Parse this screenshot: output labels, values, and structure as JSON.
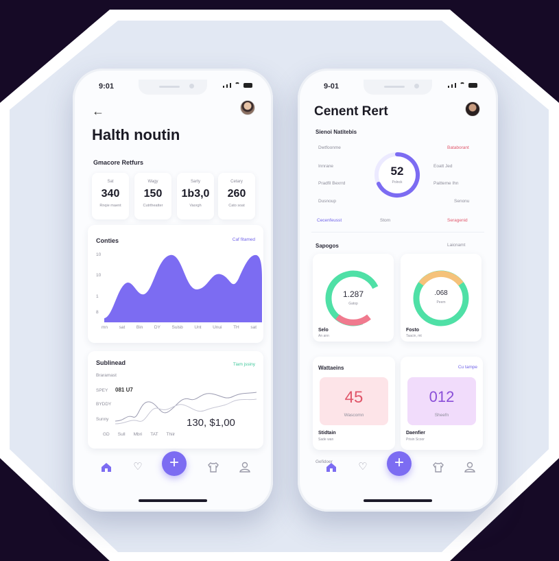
{
  "left": {
    "status_time": "9:01",
    "title": "Halth noutin",
    "stats_label": "Gmacore Retfurs",
    "stats": [
      {
        "label": "Sat",
        "value": "340",
        "sub": "Rnqie maent"
      },
      {
        "label": "Wagy",
        "value": "150",
        "sub": "Cutrtheatter"
      },
      {
        "label": "Sarty",
        "value": "1b3,0",
        "sub": "Vaorgh"
      },
      {
        "label": "Cetary",
        "value": "260",
        "sub": "Cato soat"
      }
    ],
    "calories": {
      "title": "Conties",
      "link": "Caf fitamed",
      "y_ticks": [
        "10",
        "10",
        "1",
        "8"
      ],
      "x_ticks": [
        "mn",
        "sat",
        "Bin",
        "DY",
        "Sulsb",
        "Unt",
        "Unui",
        "TH",
        "sat"
      ]
    },
    "sublined": {
      "title": "Sublinead",
      "link": "Tiam jssiny",
      "caption": "Braramast",
      "y_ticks": [
        "SPEY",
        "BYDDY",
        "Sunny"
      ],
      "reading": "081 U7",
      "big_value": "130, $1,00",
      "x_ticks": [
        "GD",
        "Sull",
        "Mbri",
        "TAT",
        "Thiir"
      ]
    }
  },
  "right": {
    "status_time": "9-01",
    "title": "Cenent Rert",
    "section1_label": "Sienoi Natitebis",
    "ring_value": "52",
    "ring_sub": "Polnck",
    "rows_left": [
      "Dwtfoonme",
      "Innrane",
      "Pradfil Bexrrd",
      "Dusnoup"
    ],
    "rows_right": [
      "Bataborant",
      "Eoatt   Jed",
      "Paitteme  Ihn",
      "Senonu"
    ],
    "bottom_left": "Cecenfeusst",
    "bottom_mid": "Stom",
    "bottom_right": "Seragenid",
    "section2_label": "Sapogos",
    "section2_link": "Laicnamt",
    "donuts": [
      {
        "value": "1.287",
        "sub": "Gatop",
        "caption": "Selo",
        "caption_sub": "An ann"
      },
      {
        "value": ".068",
        "sub": "Peem",
        "caption": "Fosto",
        "caption_sub": "Taacin, mt"
      }
    ],
    "section3_label": "Wattaeins",
    "section3_link": "Cu tampe",
    "tiles": [
      {
        "value": "45",
        "sub": "Wascomn",
        "caption": "Stidtain",
        "caption_sub": "Sade wan"
      },
      {
        "value": "012",
        "sub": "Sheefn",
        "caption": "Daenfier",
        "caption_sub": "Prisin Scoor"
      }
    ],
    "footer_peek": "Gefidoer"
  },
  "colors": {
    "accent": "#7c6cf2",
    "green": "#4fe0a6",
    "pink": "#f07a8e",
    "orange": "#f5c27a",
    "bg": "#160a26"
  },
  "icons": [
    "back-arrow-icon",
    "home-icon",
    "heart-icon",
    "plus-icon",
    "shirt-icon",
    "user-icon"
  ]
}
